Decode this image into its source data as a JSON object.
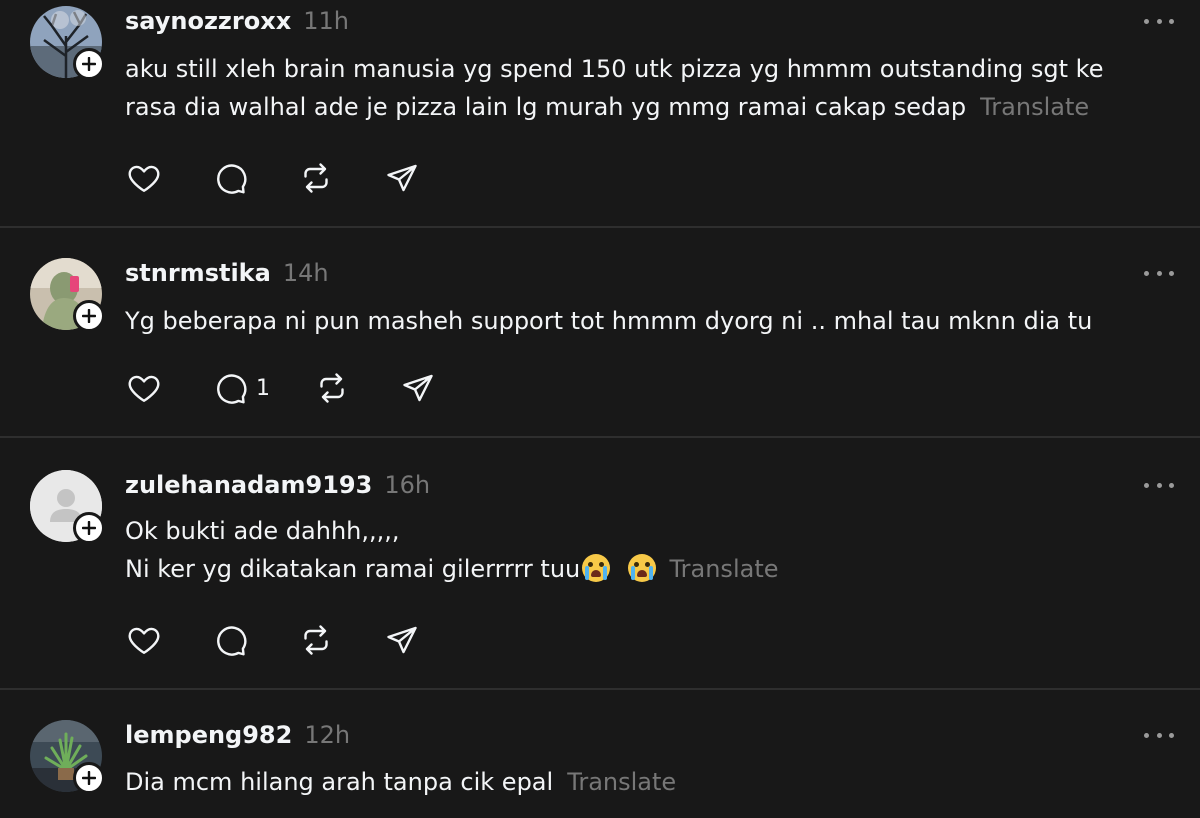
{
  "posts": [
    {
      "username": "saynozzroxx",
      "time": "11h",
      "text_lines": [
        "aku still xleh brain manusia yg spend 150 utk pizza yg hmmm outstanding sgt ke",
        "rasa dia walhal ade je pizza lain lg murah yg mmg ramai cakap sedap"
      ],
      "translate": "Translate",
      "reply_count": "",
      "avatar": "tree-photo"
    },
    {
      "username": "stnrmstika",
      "time": "14h",
      "text_lines": [
        "Yg beberapa ni pun masheh support tot hmmm dyorg ni .. mhal tau mknn dia tu"
      ],
      "translate": "",
      "reply_count": "1",
      "avatar": "selfie-photo"
    },
    {
      "username": "zulehanadam9193",
      "time": "16h",
      "text_lines": [
        "Ok bukti ade dahhh,,,,,",
        "Ni ker yg dikatakan ramai gilerrrrr tuu"
      ],
      "translate": "Translate",
      "reply_count": "",
      "avatar": "default-avatar"
    },
    {
      "username": "lempeng982",
      "time": "12h",
      "text_lines": [
        "Dia mcm hilang arah tanpa cik epal"
      ],
      "translate": "Translate",
      "reply_count": "",
      "avatar": "plant-photo"
    }
  ],
  "icons": {
    "like": "heart-icon",
    "reply": "comment-icon",
    "repost": "repost-icon",
    "share": "send-icon",
    "more": "more-icon",
    "follow": "plus-icon",
    "emoji": "crying-face-emoji"
  },
  "colors": {
    "background": "#181818",
    "text": "#f3f5f7",
    "muted": "#777777",
    "divider": "#2e2e2e"
  }
}
